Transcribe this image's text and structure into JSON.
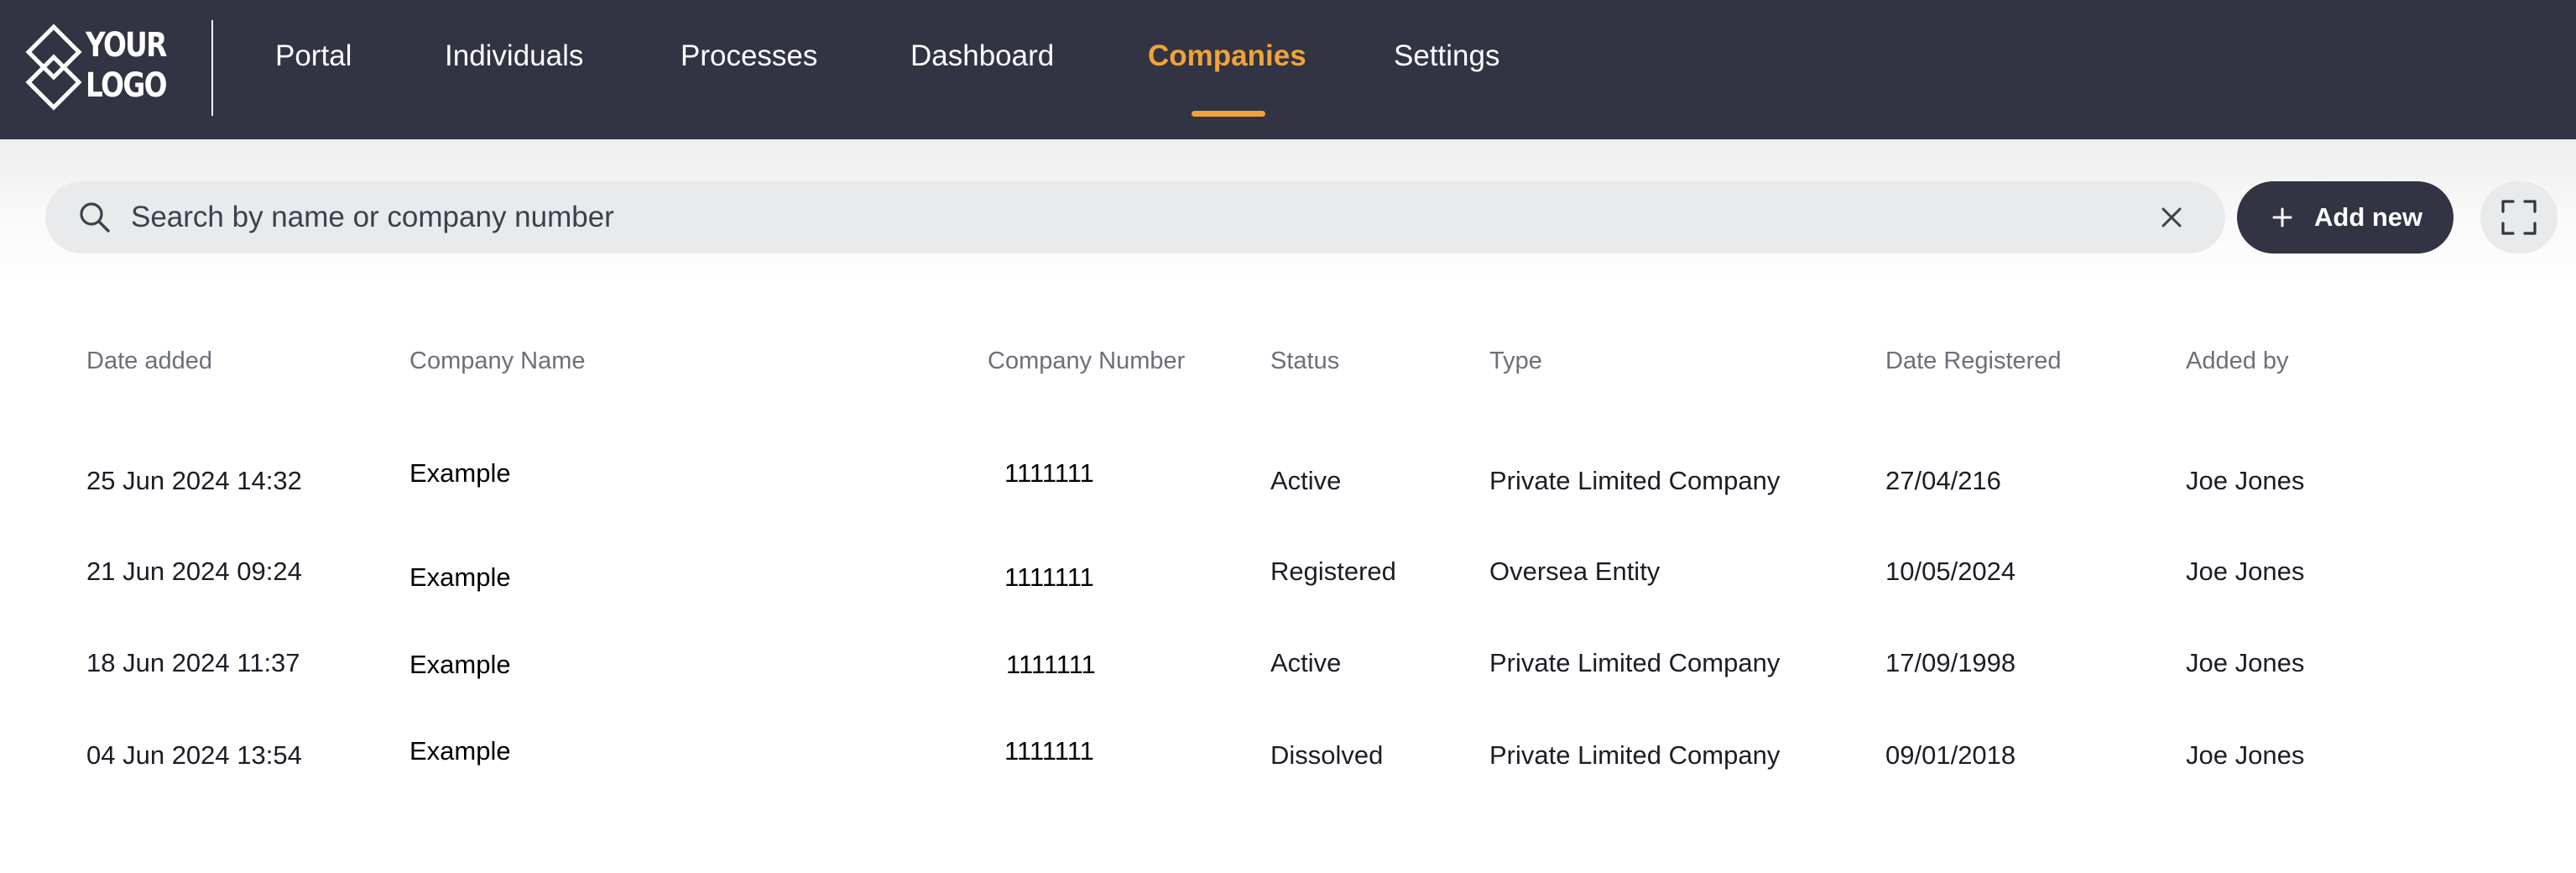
{
  "brand": {
    "logo_text_line1": "YOUR",
    "logo_text_line2": "LOGO",
    "accent_color": "#f0a33a",
    "nav_bg_color": "#323443"
  },
  "nav": {
    "items": [
      {
        "label": "Portal",
        "active": false
      },
      {
        "label": "Individuals",
        "active": false
      },
      {
        "label": "Processes",
        "active": false
      },
      {
        "label": "Dashboard",
        "active": false
      },
      {
        "label": "Companies",
        "active": true
      },
      {
        "label": "Settings",
        "active": false
      }
    ]
  },
  "toolbar": {
    "search_placeholder": "Search by name or company number",
    "search_value": "",
    "search_icon": "search-icon",
    "clear_icon": "close-icon",
    "add_label": "Add new",
    "add_icon": "plus-icon",
    "expand_icon": "fullscreen-icon"
  },
  "table": {
    "columns": [
      "Date added",
      "Company Name",
      "Company Number",
      "Status",
      "Type",
      "Date Registered",
      "Added by"
    ],
    "rows": [
      {
        "date_added": "25 Jun 2024 14:32",
        "company_name": "Example",
        "company_number": "1111111",
        "status": "Active",
        "type": "Private Limited Company",
        "date_registered": "27/04/216",
        "added_by": "Joe Jones"
      },
      {
        "date_added": "21 Jun 2024 09:24",
        "company_name": "Example",
        "company_number": "1111111",
        "status": "Registered",
        "type": "Oversea Entity",
        "date_registered": "10/05/2024",
        "added_by": "Joe Jones"
      },
      {
        "date_added": "18 Jun 2024  11:37",
        "company_name": "Example",
        "company_number": "1111111",
        "status": "Active",
        "type": "Private Limited Company",
        "date_registered": "17/09/1998",
        "added_by": "Joe Jones"
      },
      {
        "date_added": "04 Jun 2024 13:54",
        "company_name": "Example",
        "company_number": "1111111",
        "status": "Dissolved",
        "type": "Private Limited Company",
        "date_registered": "09/01/2018",
        "added_by": "Joe Jones"
      }
    ]
  }
}
